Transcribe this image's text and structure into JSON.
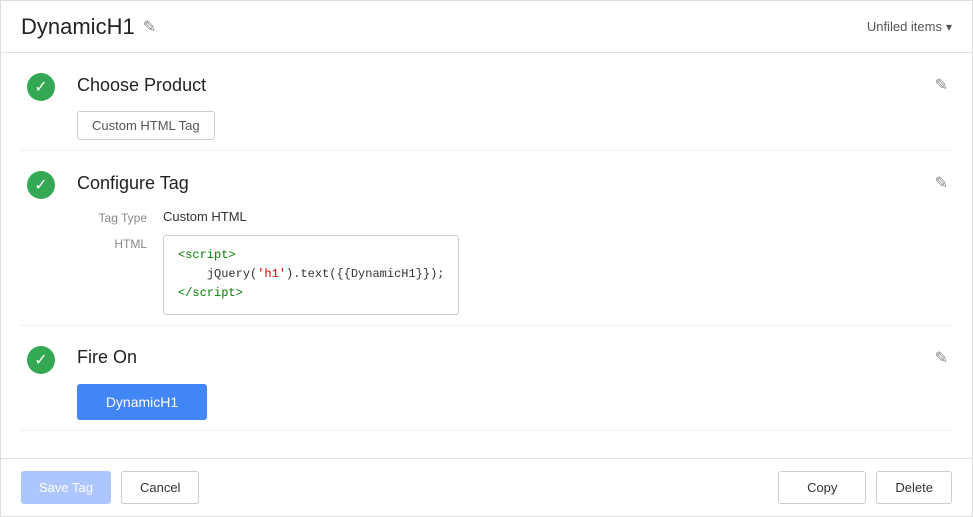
{
  "header": {
    "title": "DynamicH1",
    "unfiled_label": "Unfiled items"
  },
  "sections": {
    "choose_product": {
      "title": "Choose Product",
      "tag_label": "Custom HTML Tag"
    },
    "configure_tag": {
      "title": "Configure Tag",
      "tag_type_label": "Tag Type",
      "tag_type_value": "Custom HTML",
      "html_label": "HTML",
      "code_line1": "<script>",
      "code_line2": "    jQuery('h1').text({{DynamicH1}});",
      "code_line3": "</script>"
    },
    "fire_on": {
      "title": "Fire On",
      "trigger_label": "DynamicH1"
    }
  },
  "footer": {
    "save_label": "Save Tag",
    "cancel_label": "Cancel",
    "copy_label": "Copy",
    "delete_label": "Delete"
  },
  "icons": {
    "checkmark": "✓",
    "pencil": "✎",
    "chevron_down": "▾"
  }
}
